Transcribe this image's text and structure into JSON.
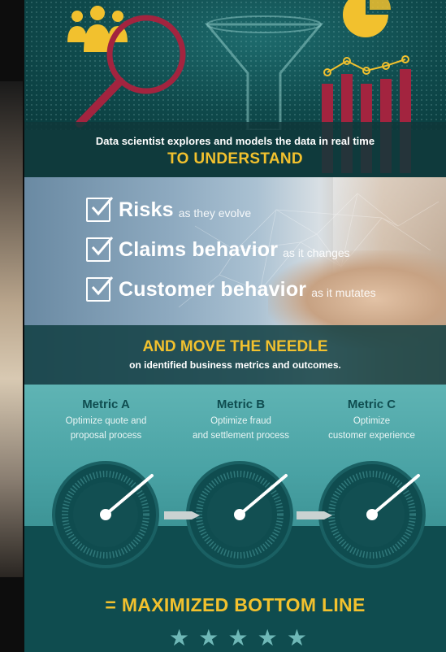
{
  "understand": {
    "subtitle": "Data scientist explores and models the data in real time",
    "heading": "TO UNDERSTAND"
  },
  "checklist": [
    {
      "main": "Risks",
      "sub": "as they evolve"
    },
    {
      "main": "Claims behavior",
      "sub": "as it changes"
    },
    {
      "main": "Customer behavior",
      "sub": "as it mutates"
    }
  ],
  "needle": {
    "heading": "AND MOVE THE NEEDLE",
    "subtitle": "on identified business metrics and outcomes."
  },
  "metrics": [
    {
      "name": "Metric A",
      "line1": "Optimize quote and",
      "line2": "proposal process"
    },
    {
      "name": "Metric B",
      "line1": "Optimize fraud",
      "line2": "and settlement process"
    },
    {
      "name": "Metric C",
      "line1": "Optimize",
      "line2": "customer experience"
    }
  ],
  "bottom_line": "= MAXIMIZED BOTTOM LINE",
  "stars": [
    "★",
    "★",
    "★",
    "★",
    "★"
  ],
  "colors": {
    "accent_yellow": "#f2c12e",
    "crimson": "#a3243f",
    "teal_dark": "#0f4c4f",
    "teal_light": "#5fb4b4"
  },
  "icons": [
    "people-icon",
    "magnifier-icon",
    "funnel-icon",
    "pie-chart-icon",
    "bar-chart-icon",
    "checkbox-icon",
    "gauge-icon",
    "star-icon"
  ]
}
